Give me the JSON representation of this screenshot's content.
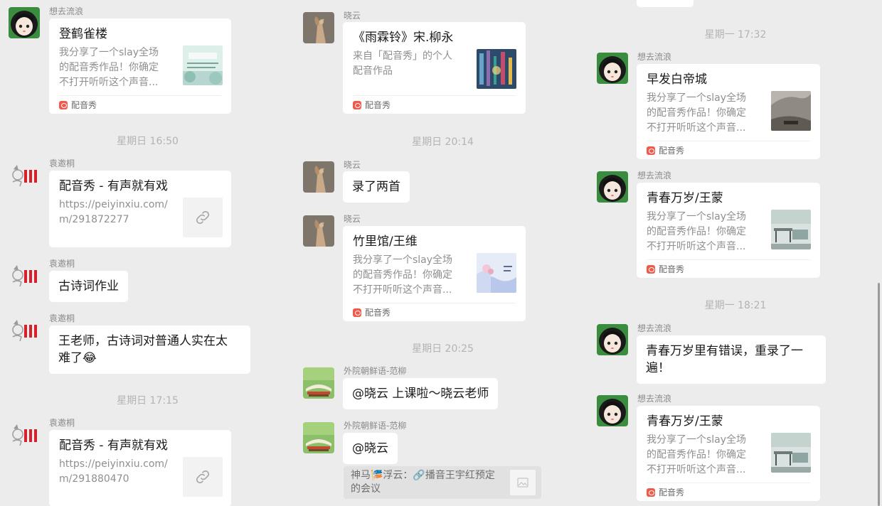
{
  "colors": {
    "background": "#ececec",
    "bubble": "#ffffff",
    "app_icon": "#ee5a4c",
    "timestamp": "#b3b3b3"
  },
  "app_label": "配音秀",
  "col1": {
    "m1": {
      "sender": "想去流浪",
      "title": "登鹤雀楼",
      "desc": "我分享了一个slay全场\n的配音秀作品！你确定\n不打开听听这个声音...",
      "footer": "配音秀",
      "thumb_caption": "《登鹳雀楼》"
    },
    "t1": "星期日 16:50",
    "m2": {
      "sender": "袁邀桐",
      "title": "配音秀 - 有声就有戏",
      "desc": "https://peiyinxiu.com/\nm/291872277"
    },
    "m3": {
      "sender": "袁邀桐",
      "text": "古诗词作业"
    },
    "m4": {
      "sender": "袁邀桐",
      "text": "王老师，古诗词对普通人实在太\n难了😂"
    },
    "t2": "星期日 17:15",
    "m5": {
      "sender": "袁邀桐",
      "title": "配音秀 - 有声就有戏",
      "desc": "https://peiyinxiu.com/\nm/291880470"
    }
  },
  "col2": {
    "m1": {
      "sender": "晓云",
      "title": "《雨霖铃》宋.柳永",
      "desc": "来自「配音秀」的个人\n配音作品",
      "footer": "配音秀"
    },
    "t1": "星期日 20:14",
    "m2": {
      "sender": "晓云",
      "text": "录了两首"
    },
    "m3": {
      "sender": "晓云",
      "title": "竹里馆/王维",
      "desc": "我分享了一个slay全场\n的配音秀作品！你确定\n不打开听听这个声音...",
      "footer": "配音秀",
      "thumb_caption": "竹里馆 王维"
    },
    "t2": "星期日 20:25",
    "m4": {
      "sender": "外院朝鲜语-范柳",
      "text": "@晓云 上课啦～晓云老师"
    },
    "m5": {
      "sender": "外院朝鲜语-范柳",
      "text": "@晓云"
    },
    "quote": {
      "text": "神马🎏浮云：🔗播音王宇红预定\n的会议"
    }
  },
  "col3": {
    "t1": "星期一 17:32",
    "m1": {
      "sender": "想去流浪",
      "title": "早发白帝城",
      "desc": "我分享了一个slay全场\n的配音秀作品！你确定\n不打开听听这个声音...",
      "footer": "配音秀"
    },
    "m2": {
      "sender": "想去流浪",
      "title": "青春万岁/王蒙",
      "desc": "我分享了一个slay全场\n的配音秀作品！你确定\n不打开听听这个声音...",
      "footer": "配音秀"
    },
    "t2": "星期一 18:21",
    "m3": {
      "sender": "想去流浪",
      "text": "青春万岁里有错误，重录了一\n遍！"
    },
    "m4": {
      "sender": "想去流浪",
      "title": "青春万岁/王蒙",
      "desc": "我分享了一个slay全场\n的配音秀作品！你确定\n不打开听听这个声音...",
      "footer": "配音秀"
    }
  }
}
